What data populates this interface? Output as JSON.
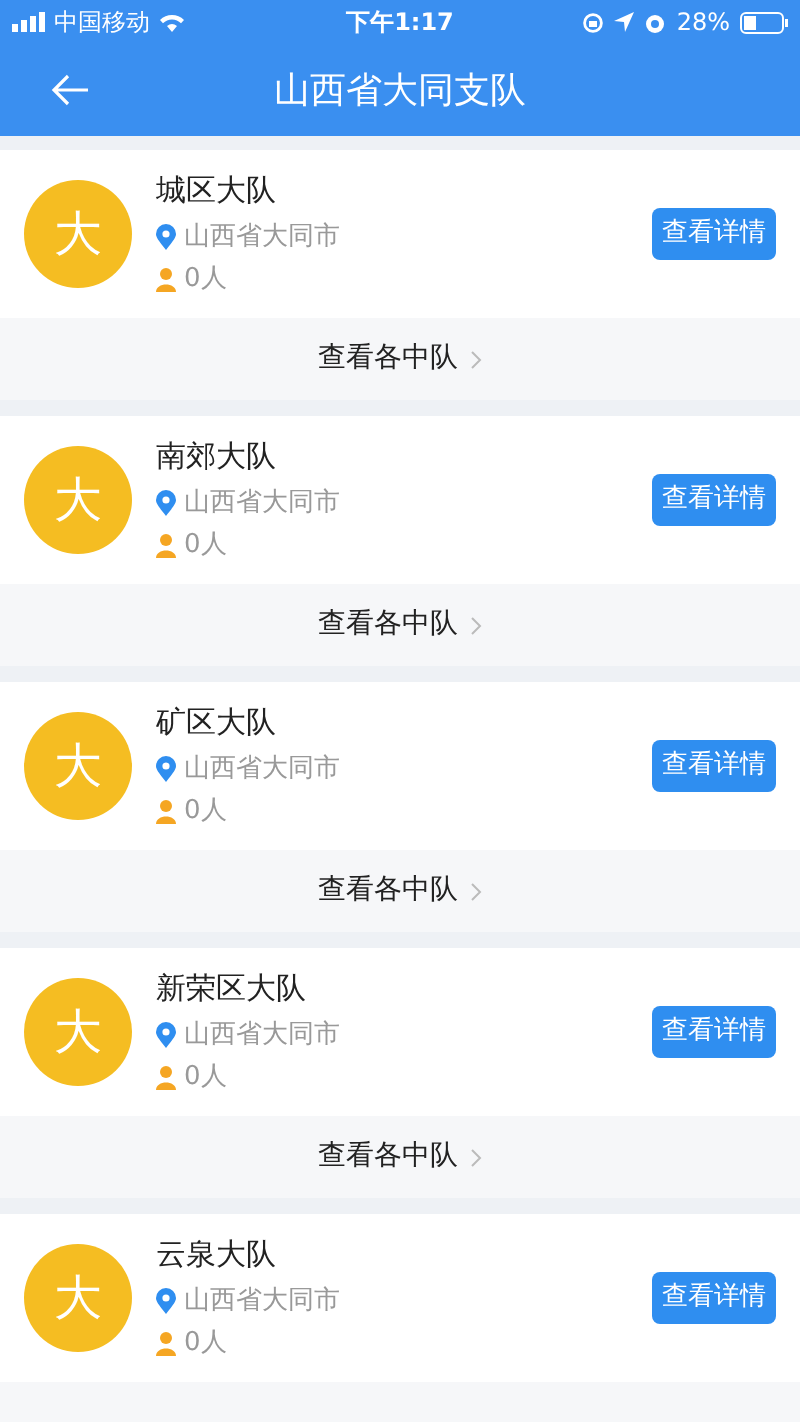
{
  "status_bar": {
    "carrier": "中国移动",
    "time": "下午1:17",
    "battery": "28%"
  },
  "nav": {
    "title": "山西省大同支队"
  },
  "brigades": [
    {
      "avatar": "大",
      "name": "城区大队",
      "location": "山西省大同市",
      "members": "0人",
      "button": "查看详情",
      "footer": "查看各中队"
    },
    {
      "avatar": "大",
      "name": "南郊大队",
      "location": "山西省大同市",
      "members": "0人",
      "button": "查看详情",
      "footer": "查看各中队"
    },
    {
      "avatar": "大",
      "name": "矿区大队",
      "location": "山西省大同市",
      "members": "0人",
      "button": "查看详情",
      "footer": "查看各中队"
    },
    {
      "avatar": "大",
      "name": "新荣区大队",
      "location": "山西省大同市",
      "members": "0人",
      "button": "查看详情",
      "footer": "查看各中队"
    },
    {
      "avatar": "大",
      "name": "云泉大队",
      "location": "山西省大同市",
      "members": "0人",
      "button": "查看详情"
    }
  ]
}
